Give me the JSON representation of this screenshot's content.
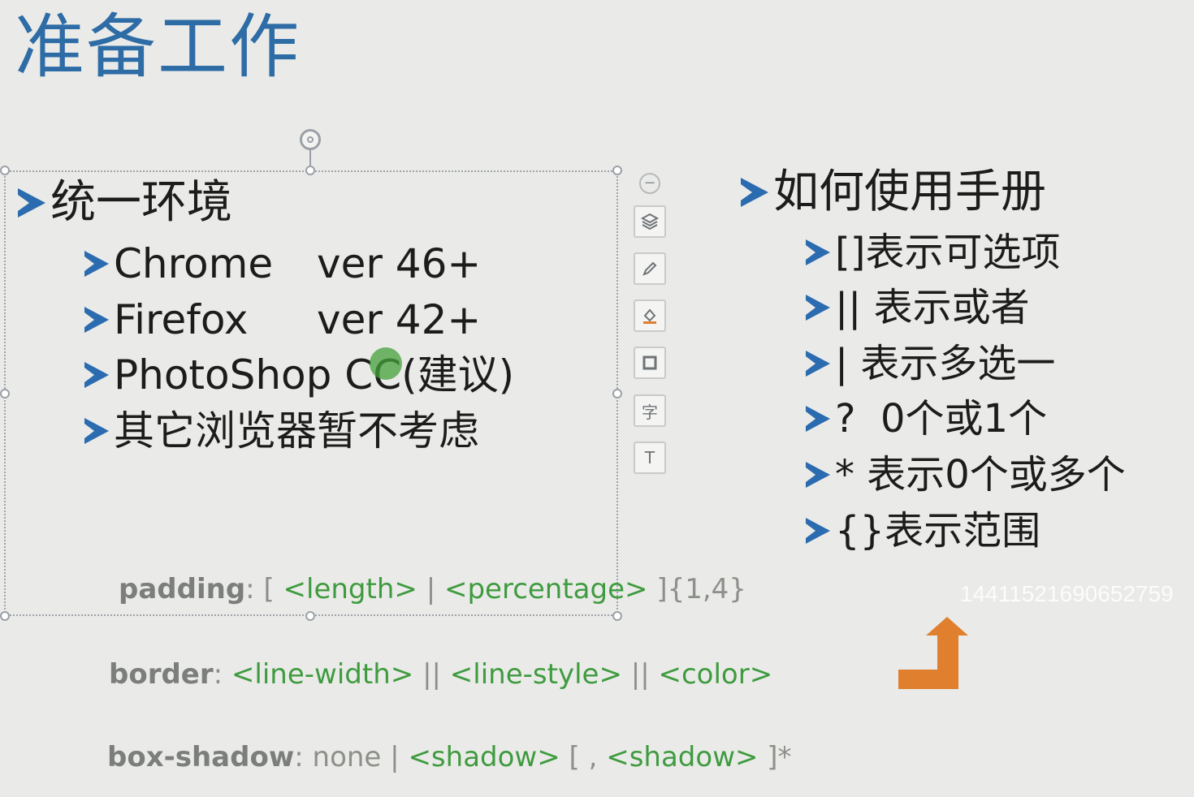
{
  "slide": {
    "title": "准备工作",
    "left_box": {
      "heading": "统一环境",
      "items": [
        {
          "label": "Chrome",
          "version": "ver 46+"
        },
        {
          "label": "Firefox",
          "version": "ver 42+"
        },
        {
          "label": "PhotoShop CC(建议)",
          "version": ""
        },
        {
          "label": "其它浏览器暂不考虑",
          "version": ""
        }
      ]
    },
    "right_box": {
      "heading": "如何使用手册",
      "items": [
        "[]表示可选项",
        "|| 表示或者",
        "| 表示多选一",
        "?  0个或1个",
        "* 表示0个或多个",
        "{}表示范围"
      ]
    },
    "syntax": {
      "padding": {
        "prop": "padding",
        "colon": ":",
        "parts": [
          "[",
          "<length>",
          "|",
          "<percentage>",
          "]{1,4}"
        ]
      },
      "border": {
        "prop": "border",
        "colon": ":",
        "parts": [
          "<line-width>",
          "||",
          "<line-style>",
          "||",
          "<color>"
        ]
      },
      "box_shadow": {
        "prop": "box-shadow",
        "colon": ":",
        "parts": [
          "none",
          "|",
          "<shadow>",
          "[ ,",
          "<shadow>",
          "]*"
        ]
      }
    },
    "watermark": "144115216906527​59",
    "toolbar": {
      "icons": [
        "collapse-icon",
        "layers-icon",
        "pen-icon",
        "fill-icon",
        "outline-icon",
        "font-icon",
        "text-style-icon"
      ],
      "font_glyph": "字",
      "text_style_glyph": "T"
    },
    "colors": {
      "title": "#2e6ca6",
      "bullet": "#2b6bb0",
      "syntax_value": "#3f9b3f",
      "arrow_orange": "#e07f2e"
    }
  }
}
